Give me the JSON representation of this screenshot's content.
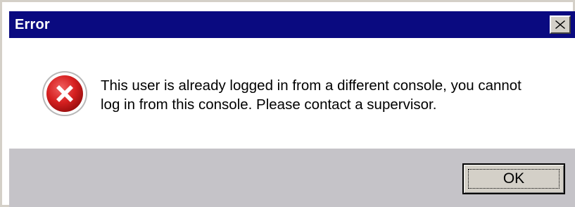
{
  "window": {
    "title": "Error",
    "close_icon": "close-icon"
  },
  "message": {
    "icon": "error-icon",
    "line1": "This user is already logged in from a different console, you cannot",
    "line2": "log in from this console. Please contact a supervisor."
  },
  "buttons": {
    "ok_label": "OK"
  },
  "colors": {
    "title_bar": "#0a0a80",
    "button_area": "#c5c3c8",
    "icon_red": "#d62020"
  }
}
